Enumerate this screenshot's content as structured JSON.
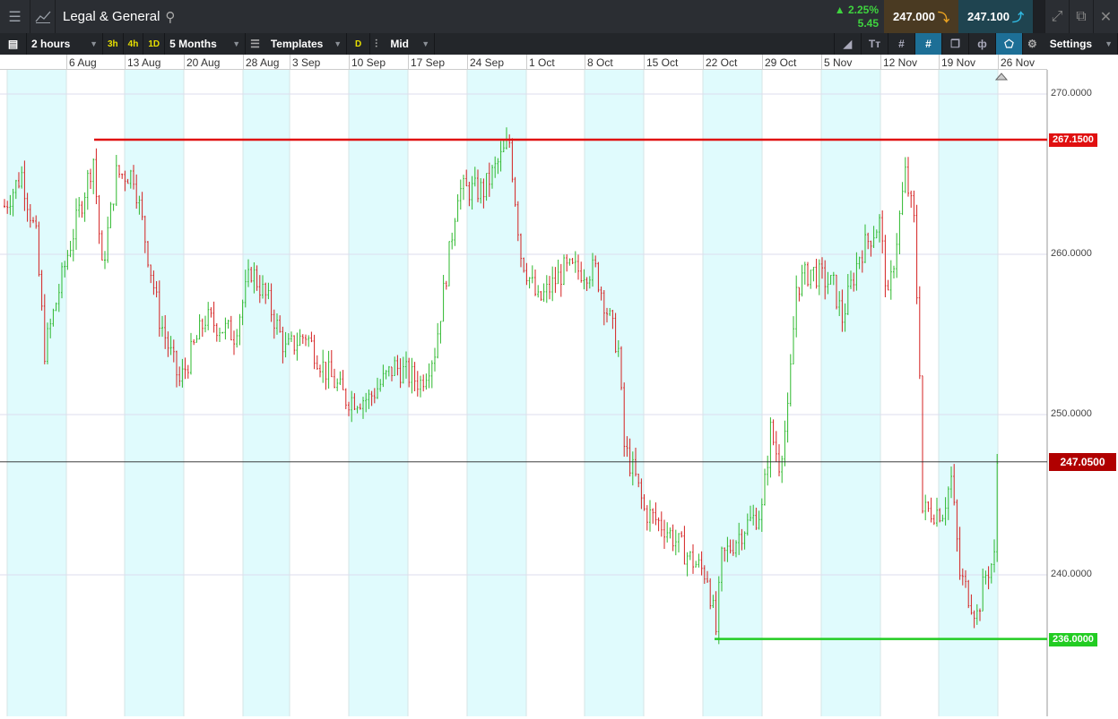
{
  "header": {
    "title": "Legal & General",
    "change_pct": "2.25%",
    "change_abs": "5.45",
    "bid": "247.000",
    "ask": "247.100"
  },
  "toolbar": {
    "interval": "2 hours",
    "quick": [
      "3h",
      "4h",
      "1D"
    ],
    "range": "5 Months",
    "templates": "Templates",
    "d": "D",
    "price_type": "Mid",
    "settings": "Settings"
  },
  "colors": {
    "up": "#2db82d",
    "down": "#d42020",
    "resistance": "#e01010",
    "support": "#22cc22",
    "current": "#b00000",
    "shade": "#e0fbfd"
  },
  "chart_data": {
    "type": "ohlc",
    "x_labels": [
      "6 Aug",
      "13 Aug",
      "20 Aug",
      "28 Aug",
      "3 Sep",
      "10 Sep",
      "17 Sep",
      "24 Sep",
      "1 Oct",
      "8 Oct",
      "15 Oct",
      "22 Oct",
      "29 Oct",
      "5 Nov",
      "12 Nov",
      "19 Nov",
      "26 Nov"
    ],
    "y_ticks": [
      "270.0000",
      "260.0000",
      "250.0000",
      "240.0000"
    ],
    "y_tick_values": [
      270,
      260,
      250,
      240
    ],
    "ylim": [
      232,
      272
    ],
    "resistance": {
      "value": 267.15,
      "label": "267.1500"
    },
    "support": {
      "value": 236.0,
      "label": "236.0000"
    },
    "current": {
      "value": 247.05,
      "label": "247.0500"
    },
    "path_keypoints": [
      [
        0,
        263
      ],
      [
        6,
        265
      ],
      [
        11,
        261
      ],
      [
        14,
        254
      ],
      [
        22,
        260
      ],
      [
        31,
        266
      ],
      [
        34,
        259
      ],
      [
        39,
        265
      ],
      [
        45,
        265
      ],
      [
        50,
        260
      ],
      [
        54,
        256
      ],
      [
        61,
        252
      ],
      [
        70,
        256
      ],
      [
        80,
        255
      ],
      [
        86,
        259
      ],
      [
        92,
        257
      ],
      [
        98,
        254
      ],
      [
        105,
        255
      ],
      [
        111,
        253
      ],
      [
        119,
        251
      ],
      [
        127,
        251
      ],
      [
        136,
        253
      ],
      [
        145,
        252
      ],
      [
        150,
        254
      ],
      [
        155,
        260
      ],
      [
        158,
        264
      ],
      [
        167,
        264
      ],
      [
        176,
        267
      ],
      [
        180,
        260
      ],
      [
        186,
        257
      ],
      [
        195,
        259
      ],
      [
        202,
        259
      ],
      [
        206,
        259
      ],
      [
        214,
        254
      ],
      [
        216,
        248
      ],
      [
        220,
        246
      ],
      [
        223,
        244
      ],
      [
        230,
        243
      ],
      [
        239,
        241
      ],
      [
        245,
        240
      ],
      [
        248,
        236.5
      ],
      [
        250,
        241
      ],
      [
        258,
        243
      ],
      [
        264,
        244
      ],
      [
        267,
        249
      ],
      [
        270,
        247
      ],
      [
        273,
        250
      ],
      [
        276,
        258
      ],
      [
        281,
        259
      ],
      [
        289,
        258
      ],
      [
        292,
        256
      ],
      [
        298,
        260
      ],
      [
        305,
        262
      ],
      [
        308,
        257
      ],
      [
        314,
        265
      ],
      [
        317,
        262
      ],
      [
        319,
        253
      ],
      [
        320,
        244
      ],
      [
        327,
        244
      ],
      [
        330,
        246
      ],
      [
        333,
        240
      ],
      [
        339,
        237.5
      ],
      [
        342,
        240
      ],
      [
        345,
        241
      ],
      [
        346,
        247
      ]
    ]
  }
}
